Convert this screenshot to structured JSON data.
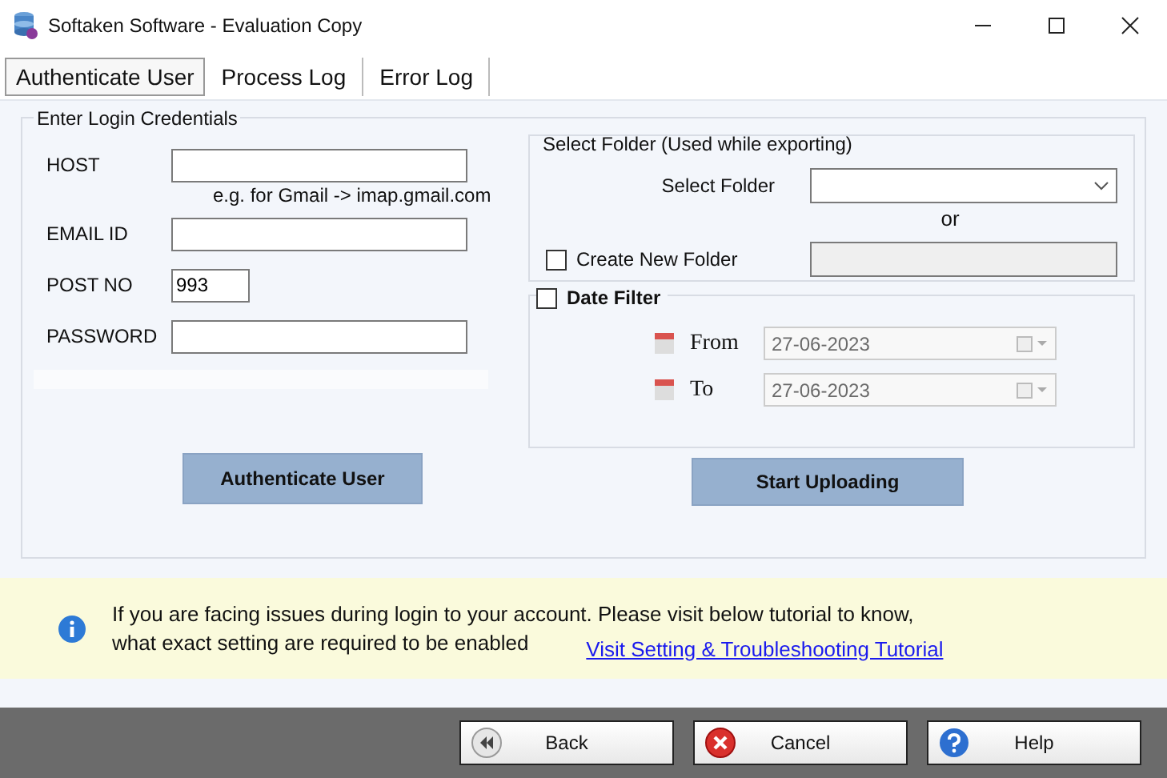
{
  "window": {
    "title": "Softaken Software - Evaluation Copy"
  },
  "tabs": [
    {
      "label": "Authenticate User",
      "selected": true
    },
    {
      "label": "Process Log",
      "selected": false
    },
    {
      "label": "Error Log",
      "selected": false
    }
  ],
  "login": {
    "legend": "Enter Login Credentials",
    "fields": [
      {
        "label": "HOST",
        "hint": "e.g. for Gmail -> imap.gmail.com",
        "kind": "wide"
      },
      {
        "label": "EMAIL ID",
        "kind": "wide"
      },
      {
        "label": "POST NO",
        "value": "993",
        "kind": "short"
      },
      {
        "label": "PASSWORD",
        "kind": "wide"
      }
    ],
    "button": "Authenticate User"
  },
  "folder": {
    "legend": "Select Folder (Used while exporting)",
    "select_label": "Select Folder",
    "or": "or",
    "create_label": "Create New Folder",
    "create_checked": false
  },
  "date_filter": {
    "label": "Date Filter",
    "checked": false,
    "dates": [
      {
        "label": "From",
        "value": "27-06-2023"
      },
      {
        "label": "To",
        "value": "27-06-2023"
      }
    ]
  },
  "upload_button": "Start Uploading",
  "info": {
    "lines": [
      "If you are facing issues during login to your account. Please visit below tutorial to know,",
      "what exact setting are required to be enabled"
    ],
    "link": "Visit Setting & Troubleshooting Tutorial"
  },
  "footer_buttons": [
    {
      "label": "Back",
      "kind": "back"
    },
    {
      "label": "Cancel",
      "kind": "cancel"
    },
    {
      "label": "Help",
      "kind": "help"
    }
  ]
}
